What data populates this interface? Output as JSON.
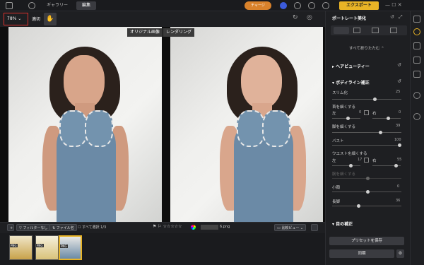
{
  "topbar": {
    "tabs": [
      {
        "label": "ギャラリー"
      },
      {
        "label": "編集"
      }
    ],
    "charge_label": "チャージ",
    "export_label": "エクスポート"
  },
  "toolbar": {
    "zoom": "78%",
    "fit_label": "適切"
  },
  "canvas": {
    "original_label": "オリジナル画像",
    "render_label": "レンダリング"
  },
  "bottombar": {
    "filter_label": "フィルターなし",
    "file_label": "ファイル名",
    "select_all_label": "すべて選択 1/3",
    "filename": "6.png",
    "compare_label": "比較ビュー",
    "thumb_badge": "PNG"
  },
  "panel": {
    "title": "ポートレート美化",
    "collapse_label": "すべて折りたたむ",
    "section_hair": "ヘアビューティー",
    "section_body": "ボディライン補正",
    "sliders": [
      {
        "label": "スリム化",
        "value": "25"
      },
      {
        "label": "首を細くする",
        "left": "左",
        "left_value": "0",
        "right": "右",
        "right_value": "0"
      },
      {
        "label": "脚を細くする",
        "value": "39"
      },
      {
        "label": "バスト",
        "value": "100"
      },
      {
        "label": "ウエストを細くする",
        "left": "左",
        "left_value": "17",
        "right": "右",
        "right_value": "55"
      },
      {
        "label": "腕を細くする",
        "value": ""
      },
      {
        "label": "小顔",
        "value": "0"
      },
      {
        "label": "長脚",
        "value": "36"
      }
    ],
    "section_eyes": "目の補正",
    "save_preset": "プリセットを保存",
    "sync_label": "同期"
  }
}
